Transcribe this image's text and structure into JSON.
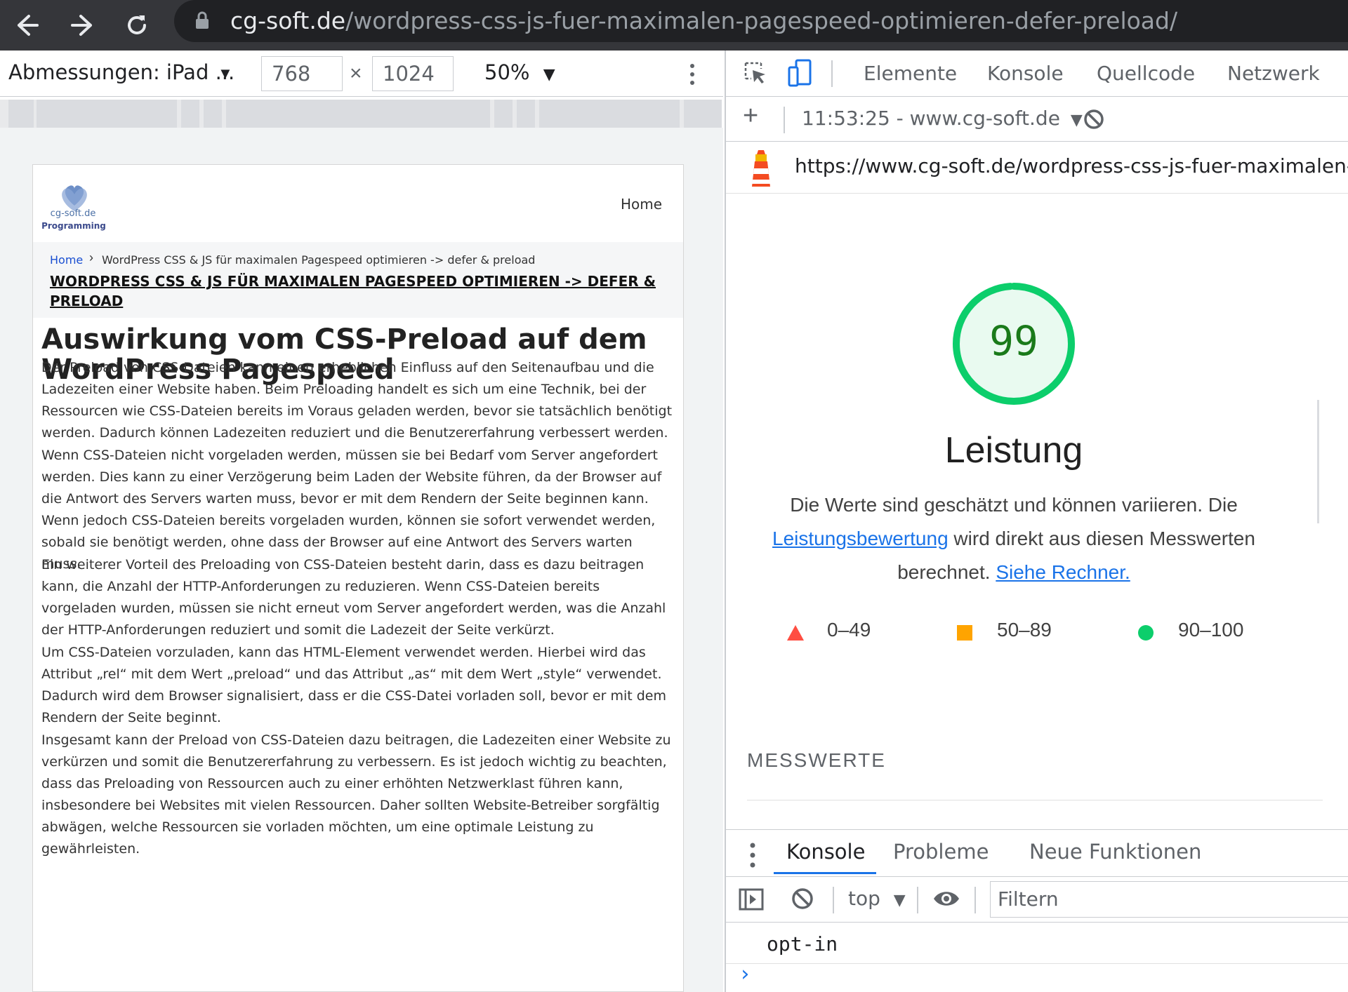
{
  "browser": {
    "url_host": "cg-soft.de",
    "url_path": "/wordpress-css-js-fuer-maximalen-pagespeed-optimieren-defer-preload/"
  },
  "device_toolbar": {
    "dimensions_label": "Abmessungen: iPad ...",
    "width_value": "768",
    "height_value": "1024",
    "times_symbol": "×",
    "zoom_label": "50%"
  },
  "website": {
    "logo_line1": "cg-soft.de",
    "logo_line2": "Programming",
    "nav_home": "Home",
    "breadcrumb_home": "Home",
    "breadcrumb_current": "WordPress CSS & JS für maximalen Pagespeed optimieren -> defer & preload",
    "post_title": "WORDPRESS CSS & JS FÜR MAXIMALEN PAGESPEED OPTIMIEREN -> DEFER & PRELOAD",
    "article_heading": "Auswirkung vom CSS-Preload auf dem WordPress Pagespeed",
    "paragraphs": [
      "Der Preload von CSS-Dateien kann einen erheblichen Einfluss auf den Seitenaufbau und die Ladezeiten einer Website haben. Beim Preloading handelt es sich um eine Technik, bei der Ressourcen wie CSS-Dateien bereits im Voraus geladen werden, bevor sie tatsächlich benötigt werden. Dadurch können Ladezeiten reduziert und die Benutzererfahrung verbessert werden.",
      "Wenn CSS-Dateien nicht vorgeladen werden, müssen sie bei Bedarf vom Server angefordert werden. Dies kann zu einer Verzögerung beim Laden der Website führen, da der Browser auf die Antwort des Servers warten muss, bevor er mit dem Rendern der Seite beginnen kann. Wenn jedoch CSS-Dateien bereits vorgeladen wurden, können sie sofort verwendet werden, sobald sie benötigt werden, ohne dass der Browser auf eine Antwort des Servers warten muss.",
      "Ein weiterer Vorteil des Preloading von CSS-Dateien besteht darin, dass es dazu beitragen kann, die Anzahl der HTTP-Anforderungen zu reduzieren. Wenn CSS-Dateien bereits vorgeladen wurden, müssen sie nicht erneut vom Server angefordert werden, was die Anzahl der HTTP-Anforderungen reduziert und somit die Ladezeit der Seite verkürzt.",
      "Um CSS-Dateien vorzuladen, kann das HTML-Element verwendet werden. Hierbei wird das Attribut „rel“ mit dem Wert „preload“ und das Attribut „as“ mit dem Wert „style“ verwendet. Dadurch wird dem Browser signalisiert, dass er die CSS-Datei vorladen soll, bevor er mit dem Rendern der Seite beginnt.",
      "Insgesamt kann der Preload von CSS-Dateien dazu beitragen, die Ladezeiten einer Website zu verkürzen und somit die Benutzererfahrung zu verbessern. Es ist jedoch wichtig zu beachten, dass das Preloading von Ressourcen auch zu einer erhöhten Netzwerklast führen kann, insbesondere bei Websites mit vielen Ressourcen. Daher sollten Website-Betreiber sorgfältig abwägen, welche Ressourcen sie vorladen möchten, um eine optimale Leistung zu gewährleisten."
    ]
  },
  "devtools": {
    "tabs": [
      "Elemente",
      "Konsole",
      "Quellcode",
      "Netzwerk"
    ],
    "lighthouse": {
      "plus": "+",
      "report_label": "11:53:25 - www.cg-soft.de",
      "url": "https://www.cg-soft.de/wordpress-css-js-fuer-maximalen-pagespeed-optimieren-defer-preload/",
      "score": "99",
      "score_fraction": 0.99,
      "category": "Leistung",
      "desc_part1": "Die Werte sind geschätzt und können variieren. Die ",
      "desc_link1": "Leistungsbewertung",
      "desc_part2": " wird direkt aus diesen Messwerten berechnet. ",
      "desc_link2": "Siehe Rechner.",
      "legend": {
        "fail": "0–49",
        "average": "50–89",
        "pass": "90–100"
      },
      "metrics_title": "MESSWERTE"
    },
    "drawer": {
      "tabs": [
        "Konsole",
        "Probleme",
        "Neue Funktionen"
      ],
      "context": "top",
      "filter_placeholder": "Filtern",
      "console_message": "opt-in",
      "prompt": "›"
    }
  },
  "colors": {
    "pass": "#0cce6b",
    "average": "#ffa400",
    "fail": "#ff4e42",
    "score_text": "#1a7a1a",
    "accent": "#1a73e8"
  }
}
